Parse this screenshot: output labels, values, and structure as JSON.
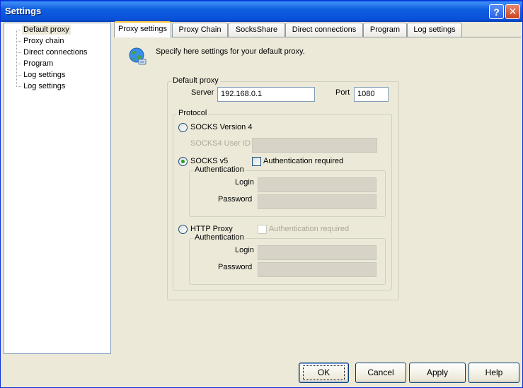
{
  "window": {
    "title": "Settings"
  },
  "titlebar_buttons": {
    "help": "?",
    "close": "✕"
  },
  "tree": {
    "items": [
      {
        "label": "Default proxy",
        "selected": true
      },
      {
        "label": "Proxy chain"
      },
      {
        "label": "Direct connections"
      },
      {
        "label": "Program"
      },
      {
        "label": "Log settings"
      },
      {
        "label": "Log settings"
      }
    ]
  },
  "tabs": [
    {
      "label": "Proxy settings",
      "active": true
    },
    {
      "label": "Proxy Chain"
    },
    {
      "label": "SocksShare"
    },
    {
      "label": "Direct connections"
    },
    {
      "label": "Program"
    },
    {
      "label": "Log settings"
    }
  ],
  "panel": {
    "icon": "globe-network-icon",
    "intro": "Specify here settings for your default proxy.",
    "default_proxy": {
      "group_label": "Default proxy",
      "server_label": "Server",
      "server_value": "192.168.0.1",
      "port_label": "Port",
      "port_value": "1080"
    },
    "protocol": {
      "group_label": "Protocol",
      "socks4": {
        "label": "SOCKS Version 4",
        "selected": false,
        "user_id_label": "SOCKS4 User ID",
        "user_id_value": ""
      },
      "socks5": {
        "label": "SOCKS v5",
        "selected": true,
        "auth_required_label": "Authentication required",
        "auth_required_checked": false,
        "auth_group_label": "Authentication",
        "login_label": "Login",
        "login_value": "",
        "password_label": "Password",
        "password_value": ""
      },
      "http": {
        "label": "HTTP Proxy",
        "selected": false,
        "auth_required_label": "Authentication required",
        "auth_required_checked": false,
        "auth_group_label": "Authentication",
        "login_label": "Login",
        "login_value": "",
        "password_label": "Password",
        "password_value": ""
      }
    }
  },
  "buttons": {
    "ok": "OK",
    "cancel": "Cancel",
    "apply": "Apply",
    "help": "Help"
  },
  "colors": {
    "titlebar": "#0a5ee8",
    "window_bg": "#ece9d8",
    "focus_tab": "#ffc83c",
    "radio_dot": "#21a121"
  }
}
